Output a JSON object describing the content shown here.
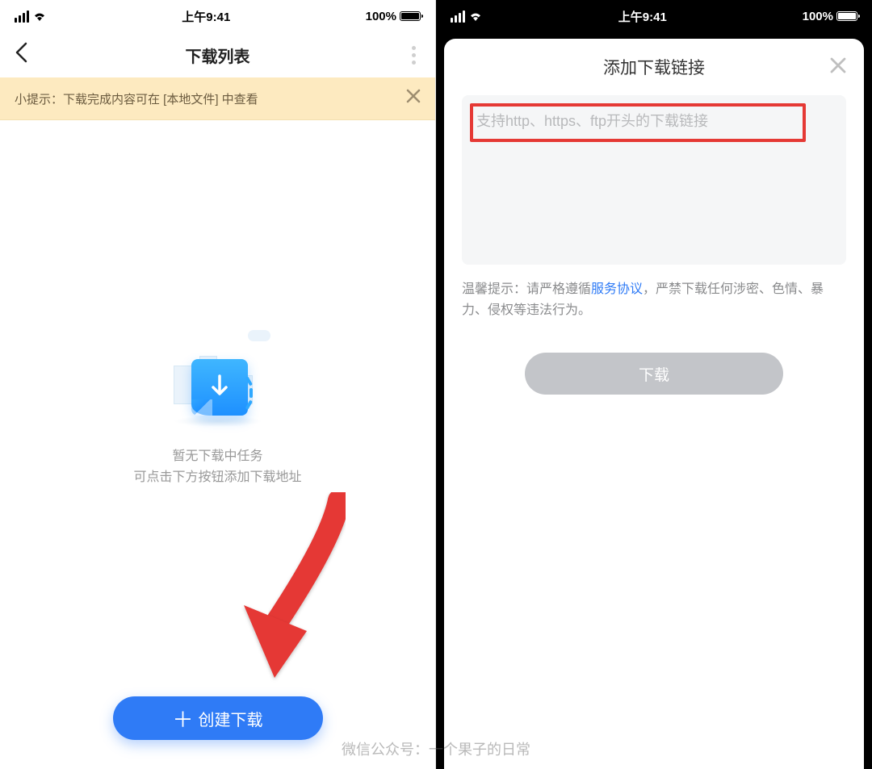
{
  "status": {
    "time": "上午9:41",
    "battery_pct": "100%"
  },
  "left": {
    "nav_title": "下载列表",
    "tip_text": "小提示：下载完成内容可在 [本地文件] 中查看",
    "empty_line1": "暂无下载中任务",
    "empty_line2": "可点击下方按钮添加下载地址",
    "create_label": "创建下载"
  },
  "right": {
    "sheet_title": "添加下载链接",
    "url_placeholder": "支持http、https、ftp开头的下载链接",
    "disclaimer_prefix": "温馨提示：请严格遵循",
    "disclaimer_link": "服务协议",
    "disclaimer_suffix": "，严禁下载任何涉密、色情、暴力、侵权等违法行为。",
    "download_label": "下载"
  },
  "watermark": "微信公众号：一个果子的日常"
}
